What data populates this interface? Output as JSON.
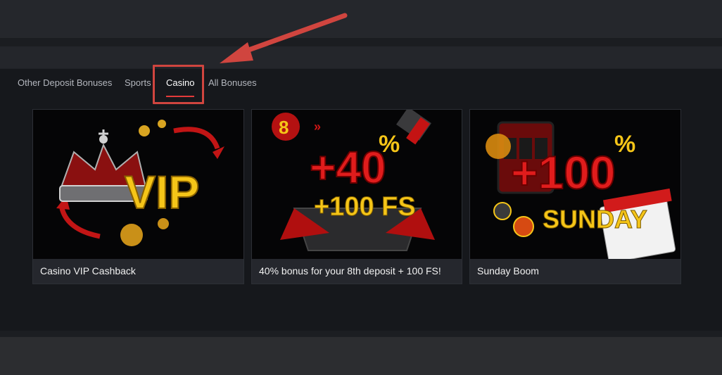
{
  "tabs": [
    {
      "label": "Other Deposit Bonuses",
      "active": false
    },
    {
      "label": "Sports",
      "active": false
    },
    {
      "label": "Casino",
      "active": true
    },
    {
      "label": "All Bonuses",
      "active": false
    }
  ],
  "cards": [
    {
      "title": "Casino VIP Cashback",
      "art_text": "VIP"
    },
    {
      "title": "40% bonus for your 8th deposit + 100 FS!",
      "art_badge": "8",
      "art_percent": "+40",
      "art_percent_sign": "%",
      "art_fs": "+100 FS"
    },
    {
      "title": "Sunday Boom",
      "art_percent": "+100",
      "art_percent_sign": "%",
      "art_sub": "SUNDAY"
    }
  ],
  "colors": {
    "accent": "#e43a3a",
    "highlight": "#d0453f",
    "gold": "#f5c518",
    "panel_bg": "#16181c"
  }
}
